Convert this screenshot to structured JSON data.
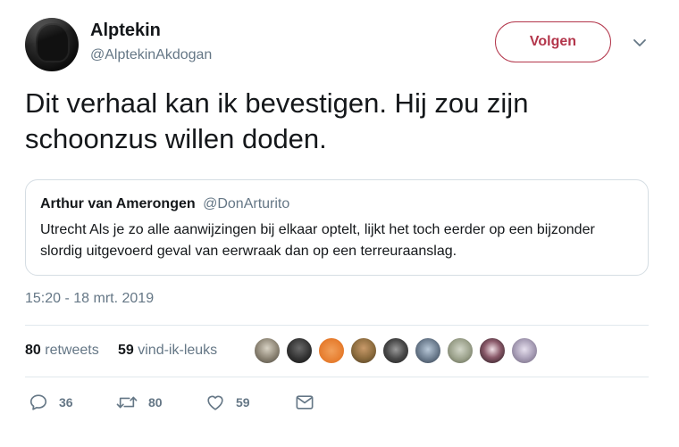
{
  "tweet": {
    "author_name": "Alptekin",
    "author_handle": "@AlptekinAkdogan",
    "follow_label": "Volgen",
    "text": "Dit verhaal kan ik bevestigen. Hij zou zijn schoonzus willen doden.",
    "timestamp": "15:20 - 18 mrt. 2019"
  },
  "quoted": {
    "author_name": "Arthur van Amerongen",
    "author_handle": "@DonArturito",
    "text": "Utrecht Als je zo alle aanwijzingen bij elkaar optelt, lijkt het toch eerder op een bijzonder slordig uitgevoerd geval van eerwraak dan op een terreuraanslag."
  },
  "stats": {
    "retweets_count": "80",
    "retweets_label": "retweets",
    "likes_count": "59",
    "likes_label": "vind-ik-leuks"
  },
  "actions": {
    "reply_count": "36",
    "retweet_count": "80",
    "like_count": "59"
  },
  "icons": {
    "reply": "reply-icon",
    "retweet": "retweet-icon",
    "like": "heart-icon",
    "message": "envelope-icon",
    "menu": "chevron-down-icon"
  },
  "colors": {
    "follow_accent": "#b3364b",
    "secondary_text": "#657786",
    "primary_text": "#14171a",
    "border": "#e1e8ed"
  }
}
